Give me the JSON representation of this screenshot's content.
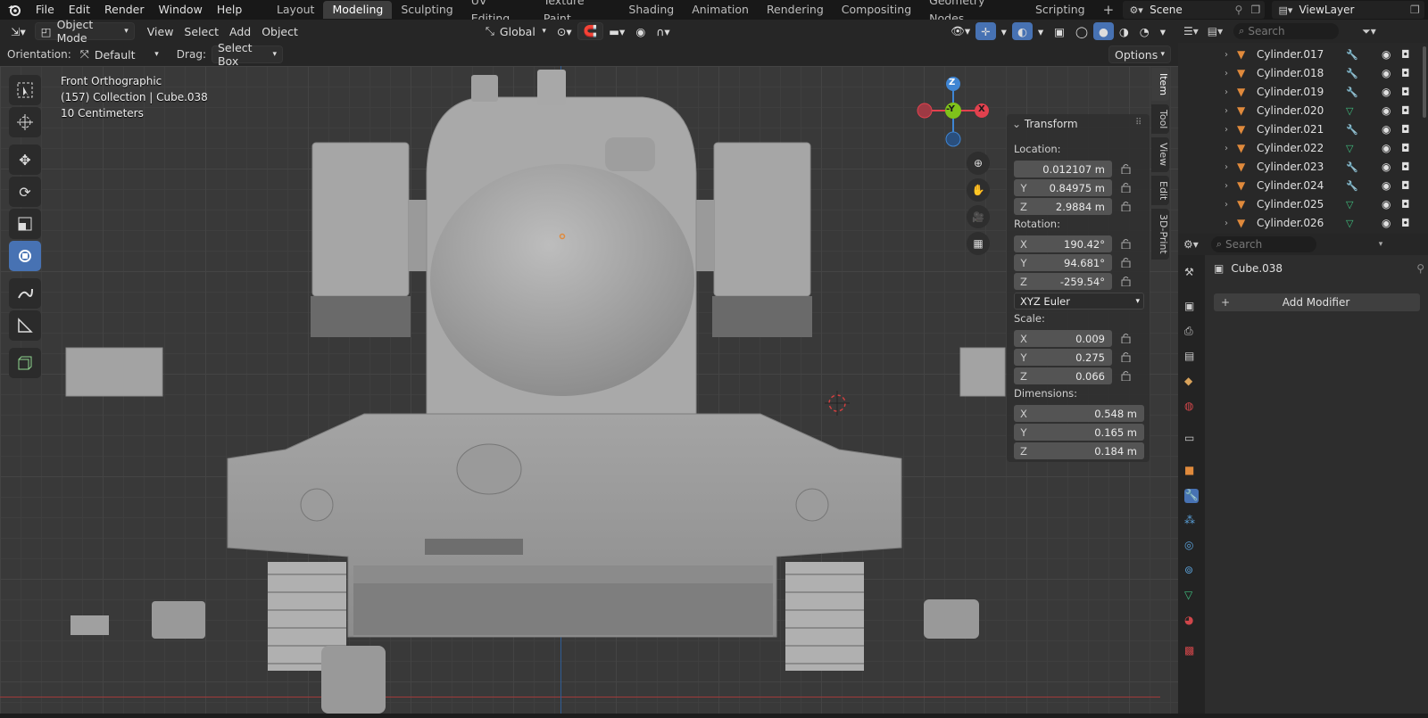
{
  "topbar": {
    "menus": [
      "File",
      "Edit",
      "Render",
      "Window",
      "Help"
    ],
    "workspaces": [
      "Layout",
      "Modeling",
      "Sculpting",
      "UV Editing",
      "Texture Paint",
      "Shading",
      "Animation",
      "Rendering",
      "Compositing",
      "Geometry Nodes",
      "Scripting"
    ],
    "active_workspace": "Modeling",
    "scene": "Scene",
    "view_layer": "ViewLayer"
  },
  "header": {
    "mode": "Object Mode",
    "menus": [
      "View",
      "Select",
      "Add",
      "Object"
    ],
    "transform_orientation": "Global"
  },
  "tool_settings": {
    "orientation_label": "Orientation:",
    "orientation_value": "Default",
    "drag_label": "Drag:",
    "drag_value": "Select Box",
    "options": "Options"
  },
  "viewport": {
    "view_name": "Front Orthographic",
    "collection_line": "(157) Collection | Cube.038",
    "scale_line": "10 Centimeters",
    "gizmo": {
      "z": "Z",
      "y": "-Y",
      "x": "X"
    }
  },
  "npanel": {
    "title": "Transform",
    "location_label": "Location:",
    "location": [
      {
        "axis": "",
        "value": "0.012107 m"
      },
      {
        "axis": "Y",
        "value": "0.84975 m"
      },
      {
        "axis": "Z",
        "value": "2.9884 m"
      }
    ],
    "rotation_label": "Rotation:",
    "rotation": [
      {
        "axis": "X",
        "value": "190.42°"
      },
      {
        "axis": "Y",
        "value": "94.681°"
      },
      {
        "axis": "Z",
        "value": "-259.54°"
      }
    ],
    "rotation_mode": "XYZ Euler",
    "scale_label": "Scale:",
    "scale": [
      {
        "axis": "X",
        "value": "0.009"
      },
      {
        "axis": "Y",
        "value": "0.275"
      },
      {
        "axis": "Z",
        "value": "0.066"
      }
    ],
    "dimensions_label": "Dimensions:",
    "dimensions": [
      {
        "axis": "X",
        "value": "0.548 m"
      },
      {
        "axis": "Y",
        "value": "0.165 m"
      },
      {
        "axis": "Z",
        "value": "0.184 m"
      }
    ],
    "tabs": [
      "Item",
      "Tool",
      "View",
      "Edit",
      "3D-Print"
    ]
  },
  "outliner": {
    "search_placeholder": "Search",
    "items": [
      {
        "name": "Cylinder.017",
        "modifier": "wrench"
      },
      {
        "name": "Cylinder.018",
        "modifier": "wrench"
      },
      {
        "name": "Cylinder.019",
        "modifier": "wrench"
      },
      {
        "name": "Cylinder.020",
        "modifier": "vertex"
      },
      {
        "name": "Cylinder.021",
        "modifier": "wrench"
      },
      {
        "name": "Cylinder.022",
        "modifier": "vertex"
      },
      {
        "name": "Cylinder.023",
        "modifier": "wrench"
      },
      {
        "name": "Cylinder.024",
        "modifier": "wrench"
      },
      {
        "name": "Cylinder.025",
        "modifier": "vertex"
      },
      {
        "name": "Cylinder.026",
        "modifier": "vertex"
      }
    ]
  },
  "properties": {
    "search_placeholder": "Search",
    "object_name": "Cube.038",
    "add_modifier": "Add Modifier"
  },
  "colors": {
    "accent": "#4772b3",
    "x_axis": "#e2414e",
    "y_axis": "#7fc21a",
    "z_axis": "#3f85d3",
    "object_orange": "#e08a3c"
  }
}
